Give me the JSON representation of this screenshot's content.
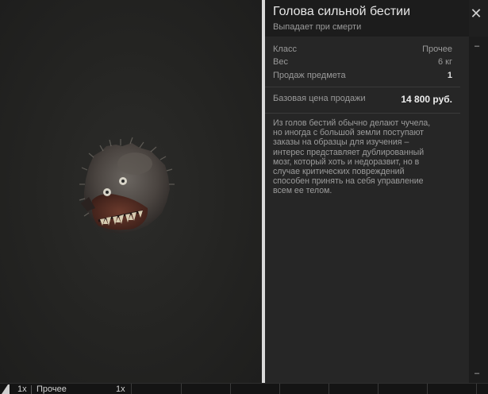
{
  "item": {
    "title": "Голова сильной бестии",
    "subtitle": "Выпадает при смерти"
  },
  "stats": [
    {
      "label": "Класс",
      "value": "Прочее"
    },
    {
      "label": "Вес",
      "value": "6 кг"
    },
    {
      "label": "Продаж предмета",
      "value": "1"
    }
  ],
  "base_price": {
    "label": "Базовая цена продажи",
    "value": "14 800 руб."
  },
  "description_lines": [
    "Из голов бестий обычно делают чучела,",
    "но иногда с большой земли поступают",
    "заказы на образцы для изучения –",
    "интерес представляет дублированный",
    "мозг, который хоть и недоразвит, но в",
    "случае критических повреждений",
    "способен принять на себя управление",
    "всем ее телом."
  ],
  "controls": {
    "close": "✕",
    "scroll_up": "–",
    "scroll_down": "–"
  },
  "bottom_bar": {
    "count_1": "1x",
    "category": "Прочее",
    "count_2": "1x"
  },
  "icons": [
    "close-icon",
    "scroll-up-icon",
    "scroll-down-icon",
    "item-slot-icon"
  ]
}
